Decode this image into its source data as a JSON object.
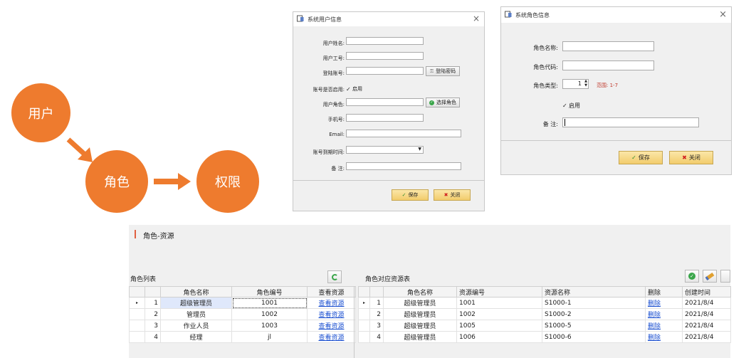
{
  "flow": {
    "user": "用户",
    "role": "角色",
    "permission": "权限"
  },
  "user_dialog": {
    "title": "系统用户信息",
    "close": "×",
    "fields": {
      "name_label": "用户姓名:",
      "code_label": "用户工号:",
      "login_label": "登陆账号:",
      "enabled_label": "账号是否启用:",
      "enabled_text": "启用",
      "role_label": "用户角色:",
      "phone_label": "手机号:",
      "email_label": "Email:",
      "expire_label": "账号到期时间:",
      "remark_label": "备  注:"
    },
    "login_pwd_button": "登陆密码",
    "select_role_button": "选择角色",
    "save_button": "保存",
    "close_button": "关闭"
  },
  "role_dialog": {
    "title": "系统角色信息",
    "close": "×",
    "name_label": "角色名称:",
    "code_label": "角色代码:",
    "type_label": "角色类型:",
    "type_value": "1",
    "range_text": "范围: 1-7",
    "enabled_text": "启用",
    "remark_label": "备  注:",
    "save_button": "保存",
    "close_button": "关闭"
  },
  "panel": {
    "title": "角色-资源",
    "role_list_title": "角色列表",
    "resource_list_title": "角色对应资源表",
    "role_table": {
      "headers": [
        "角色名称",
        "角色编号",
        "查看资源"
      ],
      "rows": [
        {
          "no": "1",
          "name": "超级管理员",
          "code": "1001",
          "view": "查看资源",
          "indicator": "▸"
        },
        {
          "no": "2",
          "name": "管理员",
          "code": "1002",
          "view": "查看资源",
          "indicator": ""
        },
        {
          "no": "3",
          "name": "作业人员",
          "code": "1003",
          "view": "查看资源",
          "indicator": ""
        },
        {
          "no": "4",
          "name": "经理",
          "code": "jl",
          "view": "查看资源",
          "indicator": ""
        }
      ]
    },
    "resource_table": {
      "headers": [
        "角色名称",
        "资源编号",
        "资源名称",
        "删除",
        "创建时间"
      ],
      "rows": [
        {
          "no": "1",
          "role": "超级管理员",
          "code": "1001",
          "name": "S1000-1",
          "del": "删除",
          "time": "2021/8/4",
          "indicator": "▸"
        },
        {
          "no": "2",
          "role": "超级管理员",
          "code": "1002",
          "name": "S1000-2",
          "del": "删除",
          "time": "2021/8/4",
          "indicator": ""
        },
        {
          "no": "3",
          "role": "超级管理员",
          "code": "1005",
          "name": "S1000-5",
          "del": "删除",
          "time": "2021/8/4",
          "indicator": ""
        },
        {
          "no": "4",
          "role": "超级管理员",
          "code": "1006",
          "name": "S1000-6",
          "del": "删除",
          "time": "2021/8/4",
          "indicator": ""
        }
      ]
    }
  },
  "icons": {
    "check": "✓",
    "x": "✖",
    "accent": "#ee7b2e",
    "link_color": "#1a4fd0",
    "range_color": "#c0392b"
  }
}
